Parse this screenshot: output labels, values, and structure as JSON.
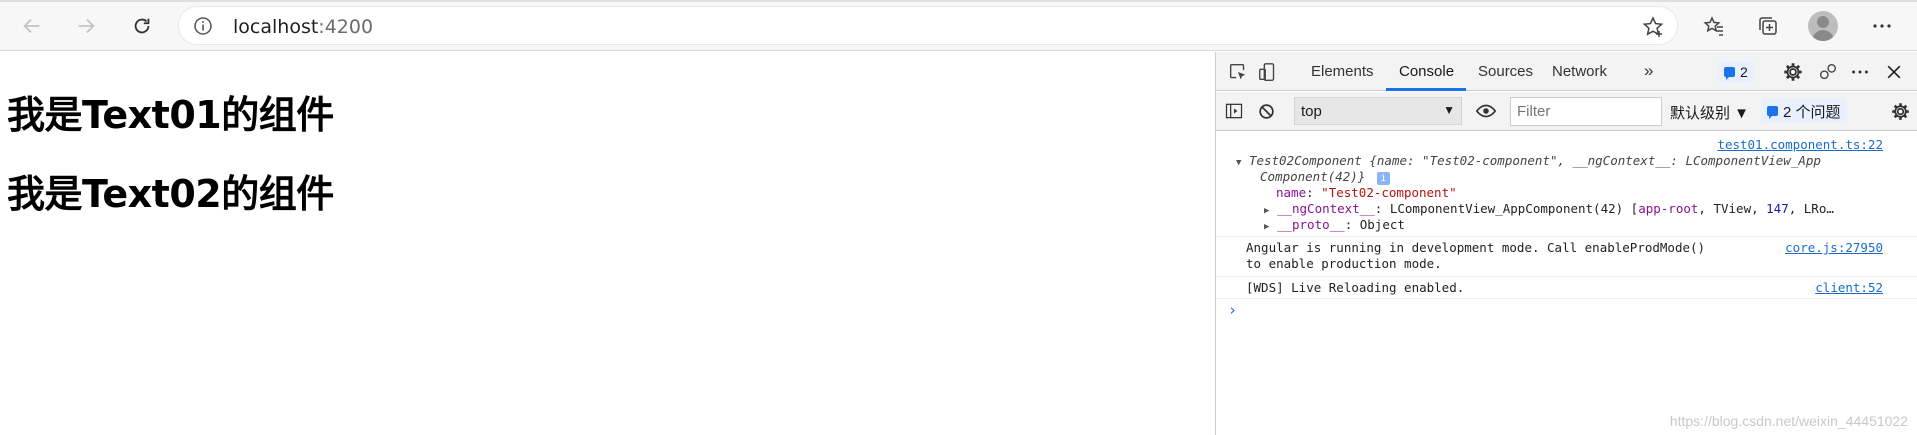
{
  "browser": {
    "url_host": "localhost",
    "url_port": ":4200"
  },
  "page": {
    "heading1": "我是Text01的组件",
    "heading2": "我是Text02的组件"
  },
  "devtools": {
    "tabs": [
      "Elements",
      "Console",
      "Sources",
      "Network"
    ],
    "more_tabs": "»",
    "issues_count": "2",
    "context": "top",
    "filter_placeholder": "Filter",
    "level": "默认级别 ▼",
    "issues_label": "2 个问题",
    "console": {
      "source1": "test01.component.ts:22",
      "obj_head_class": "Test02Component",
      "obj_head_rest": " {name: \"Test02-component\", __ngContext__: LComponentView_App",
      "obj_head_line2": "Component(42)}",
      "prop_name_key": "name",
      "prop_name_val": "\"Test02-component\"",
      "prop_ctx_key": "__ngContext__",
      "prop_ctx_val": ": LComponentView_AppComponent(42) [",
      "prop_ctx_items": "app-root",
      "prop_ctx_rest": ", TView, ",
      "prop_ctx_num": "147",
      "prop_ctx_tail": ", LRo…",
      "prop_proto_key": "__proto__",
      "prop_proto_val": ": Object",
      "msg2_line1": "Angular is running in development mode. Call enableProdMode()",
      "msg2_line2": "to enable production mode.",
      "source2": "core.js:27950",
      "msg3": "[WDS] Live Reloading enabled.",
      "source3": "client:52",
      "prompt": "›"
    },
    "watermark": "https://blog.csdn.net/weixin_44451022"
  }
}
